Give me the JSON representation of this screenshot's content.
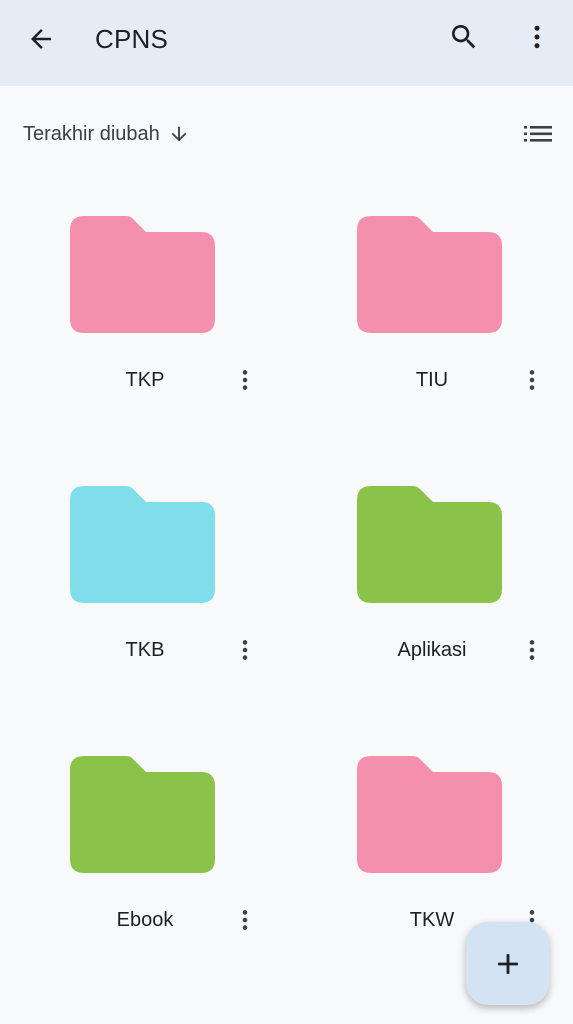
{
  "app": {
    "title": "CPNS",
    "colors": {
      "topbar_bg": "#e4edf6",
      "page_bg": "#f8f9fb",
      "fab_bg": "#d3e3f3",
      "pink": "#f490ae",
      "cyan": "#80deea",
      "green": "#8bc34a"
    }
  },
  "topbar": {
    "back_icon": "arrow-back-icon",
    "search_icon": "search-icon",
    "more_icon": "more-vert-icon"
  },
  "sort": {
    "label": "Terakhir diubah",
    "direction_icon": "arrow-downward-icon",
    "view_icon": "list-view-icon"
  },
  "folders": [
    {
      "name": "TKP",
      "color": "#f490ae"
    },
    {
      "name": "TIU",
      "color": "#f490ae"
    },
    {
      "name": "TKB",
      "color": "#80deea"
    },
    {
      "name": "Aplikasi",
      "color": "#8bc34a"
    },
    {
      "name": "Ebook",
      "color": "#8bc34a"
    },
    {
      "name": "TKW",
      "color": "#f490ae"
    }
  ],
  "fab": {
    "icon": "plus-icon"
  }
}
